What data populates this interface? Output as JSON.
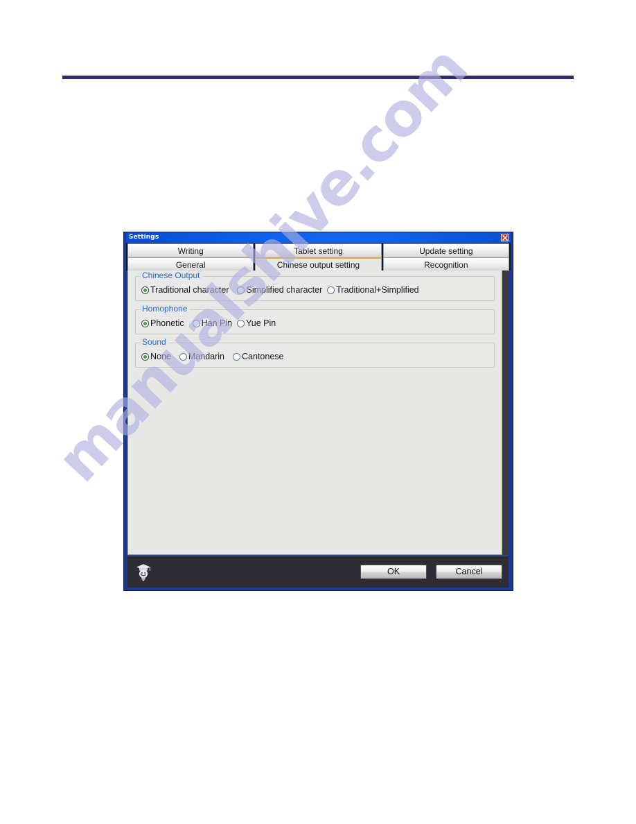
{
  "page": {
    "rule_color": "#2e2d6b",
    "watermark": "manualshive.com"
  },
  "dialog": {
    "title": "Settings",
    "close_icon": "close-x-icon",
    "accent_active_tab": "#e8a33d",
    "tab_rows": [
      {
        "tabs": [
          {
            "label": "Writing",
            "active": false
          },
          {
            "label": "Tablet setting",
            "active": false
          },
          {
            "label": "Update setting",
            "active": false
          }
        ]
      },
      {
        "tabs": [
          {
            "label": "General",
            "active": false
          },
          {
            "label": "Chinese output setting",
            "active": true
          },
          {
            "label": "Recognition",
            "active": false
          }
        ]
      }
    ],
    "groups": [
      {
        "legend": "Chinese Output",
        "options": [
          {
            "label": "Traditional character",
            "selected": true
          },
          {
            "label": "Simplified character",
            "selected": false
          },
          {
            "label": "Traditional+Simplified",
            "selected": false
          }
        ]
      },
      {
        "legend": "Homophone",
        "options": [
          {
            "label": "Phonetic",
            "selected": true
          },
          {
            "label": "Han Pin",
            "selected": false
          },
          {
            "label": "Yue Pin",
            "selected": false
          }
        ]
      },
      {
        "legend": "Sound",
        "options": [
          {
            "label": "None",
            "selected": true
          },
          {
            "label": "Mandarin",
            "selected": false
          },
          {
            "label": "Cantonese",
            "selected": false
          }
        ]
      }
    ],
    "footer": {
      "mascot_icon": "lightbulb-graduate-icon",
      "ok_label": "OK",
      "cancel_label": "Cancel"
    }
  }
}
